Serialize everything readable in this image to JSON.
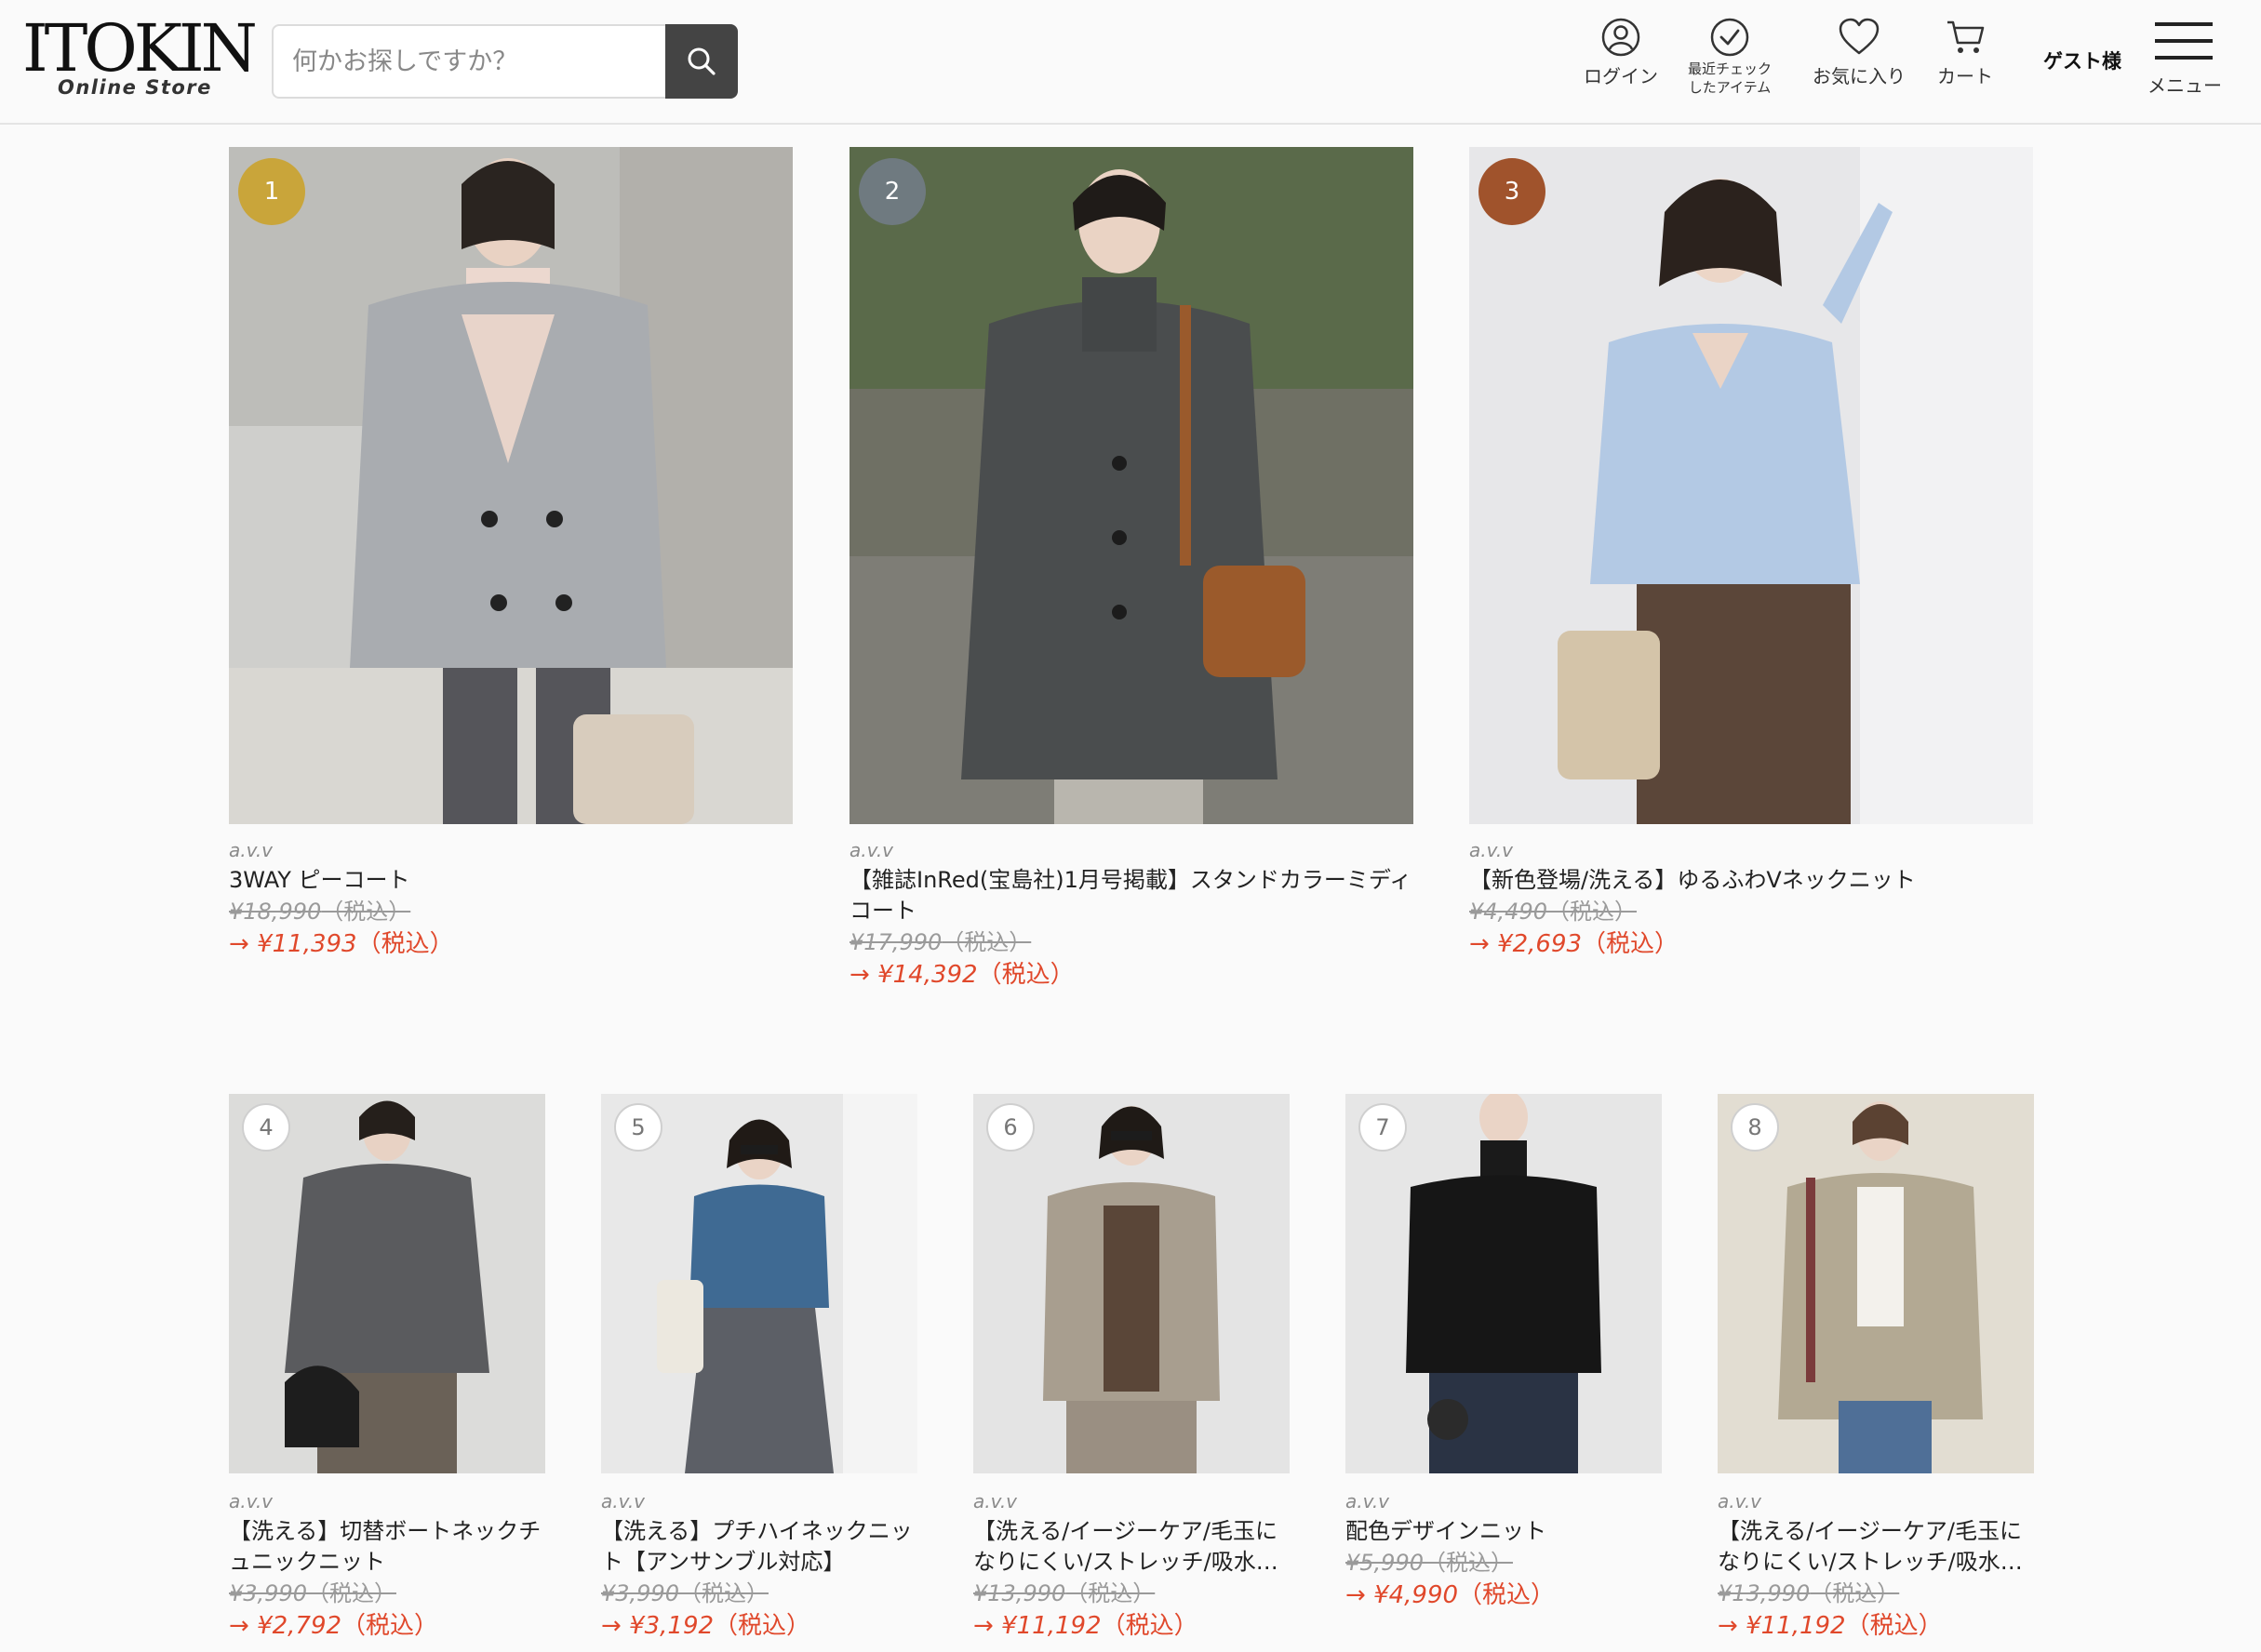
{
  "header": {
    "logo": "ITOKIN",
    "logo_sub": "Online Store",
    "search_placeholder": "何かお探しですか？",
    "nav": {
      "login": "ログイン",
      "recent_line1": "最近チェック",
      "recent_line2": "したアイテム",
      "favorites": "お気に入り",
      "cart": "カート",
      "guest": "ゲスト様",
      "menu": "メニュー"
    }
  },
  "colors": {
    "rank_gold": "#c9a53a",
    "rank_silver": "#6f7a80",
    "rank_bronze": "#a0532c",
    "sale_red": "#e0482b"
  },
  "products": [
    {
      "rank": "1",
      "brand": "a.v.v",
      "name": "3WAY ピーコート",
      "old_price": "¥18,990",
      "tax": "（税込）",
      "arrow": "→",
      "new_price": "¥11,393",
      "new_tax": "（税込）"
    },
    {
      "rank": "2",
      "brand": "a.v.v",
      "name": "【雑誌InRed(宝島社)1月号掲載】スタンドカラーミディコート",
      "old_price": "¥17,990",
      "tax": "（税込）",
      "arrow": "→",
      "new_price": "¥14,392",
      "new_tax": "（税込）"
    },
    {
      "rank": "3",
      "brand": "a.v.v",
      "name": "【新色登場/洗える】ゆるふわVネックニット",
      "old_price": "¥4,490",
      "tax": "（税込）",
      "arrow": "→",
      "new_price": "¥2,693",
      "new_tax": "（税込）"
    },
    {
      "rank": "4",
      "brand": "a.v.v",
      "name": "【洗える】切替ボートネックチュニックニット",
      "old_price": "¥3,990",
      "tax": "（税込）",
      "arrow": "→",
      "new_price": "¥2,792",
      "new_tax": "（税込）"
    },
    {
      "rank": "5",
      "brand": "a.v.v",
      "name": "【洗える】プチハイネックニット【アンサンブル対応】",
      "old_price": "¥3,990",
      "tax": "（税込）",
      "arrow": "→",
      "new_price": "¥3,192",
      "new_tax": "（税込）"
    },
    {
      "rank": "6",
      "brand": "a.v.v",
      "name": "【洗える/イージーケア/毛玉になりにくい/ストレッチ/吸水…",
      "old_price": "¥13,990",
      "tax": "（税込）",
      "arrow": "→",
      "new_price": "¥11,192",
      "new_tax": "（税込）"
    },
    {
      "rank": "7",
      "brand": "a.v.v",
      "name": "配色デザインニット",
      "old_price": "¥5,990",
      "tax": "（税込）",
      "arrow": "→",
      "new_price": "¥4,990",
      "new_tax": "（税込）"
    },
    {
      "rank": "8",
      "brand": "a.v.v",
      "name": "【洗える/イージーケア/毛玉になりにくい/ストレッチ/吸水…",
      "old_price": "¥13,990",
      "tax": "（税込）",
      "arrow": "→",
      "new_price": "¥11,192",
      "new_tax": "（税込）"
    }
  ]
}
